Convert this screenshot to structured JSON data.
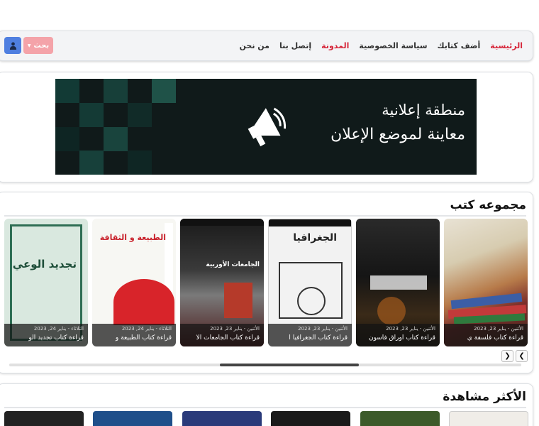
{
  "nav": {
    "links": [
      {
        "label": "الرئيسية",
        "accent": true
      },
      {
        "label": "أضف كتابك",
        "accent": false
      },
      {
        "label": "سياسة الخصوصية",
        "accent": false
      },
      {
        "label": "المدونة",
        "accent": true
      },
      {
        "label": "إتصل بنا",
        "accent": false
      },
      {
        "label": "من نحن",
        "accent": false
      }
    ],
    "search_label": "بحث",
    "search_icon": "chevron-down-icon",
    "user_icon": "user-icon"
  },
  "ad": {
    "line1": "منطقة إعلانية",
    "line2": "معاينة لموضع الإعلان",
    "icon": "megaphone-icon"
  },
  "books": {
    "title": "مجموعه كتب",
    "items": [
      {
        "date": "الأثنين - يناير 23, 2023",
        "title": "قراءة كتاب فلسفة ي"
      },
      {
        "date": "الأثنين - يناير 23, 2023",
        "title": "قراءة كتاب أوراق فاسون"
      },
      {
        "date": "الأثنين - يناير 23, 2023",
        "title": "قراءة كتاب الجغرافيا ا",
        "cover_text": "الجغرافيا"
      },
      {
        "date": "الأثنين - يناير 23, 2023",
        "title": "قراءة كتاب الجامعات الأ",
        "cover_text": "الجامعات الأوربية"
      },
      {
        "date": "الثلاثاء - يناير 24, 2023",
        "title": "قراءة كتاب الطبيعة و",
        "cover_text": "الطبيعة و الثقافة"
      },
      {
        "date": "الثلاثاء - يناير 24, 2023",
        "title": "قراءة كتاب تجديد الو",
        "cover_text": "تجديد الوعي"
      }
    ],
    "prev_icon": "chevron-left-icon",
    "next_icon": "chevron-right-icon"
  },
  "most_viewed": {
    "title": "الأكثر مشاهدة"
  }
}
